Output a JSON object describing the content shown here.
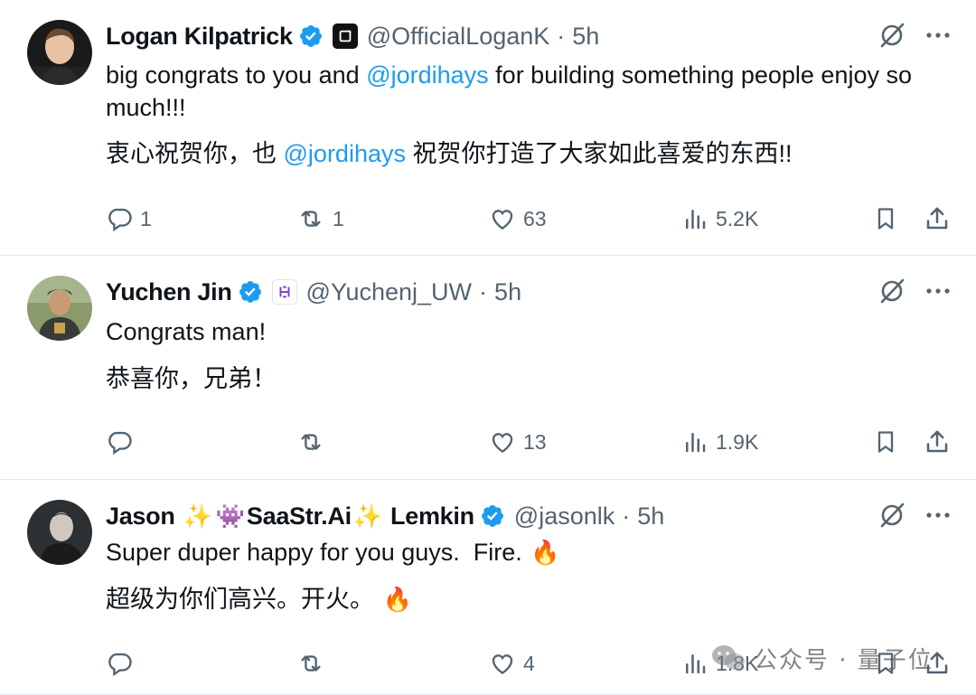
{
  "tweets": [
    {
      "name": "Logan Kilpatrick",
      "handle": "@OfficialLoganK",
      "dot": "·",
      "time": "5h",
      "line1_pre": "big congrats to you and ",
      "line1_mention": "@jordihays",
      "line1_post": " for building something people enjoy so much!!!",
      "line2_pre": "衷心祝贺你，也 ",
      "line2_mention": "@jordihays",
      "line2_post": " 祝贺你打造了大家如此喜爱的东西!!",
      "replies": "1",
      "retweets": "1",
      "likes": "63",
      "views": "5.2K"
    },
    {
      "name": "Yuchen Jin",
      "handle": "@Yuchenj_UW",
      "dot": "·",
      "time": "5h",
      "line1": "Congrats man!",
      "line2": "恭喜你，兄弟！",
      "replies": "",
      "retweets": "",
      "likes": "13",
      "views": "1.9K"
    },
    {
      "name_part1": "Jason ",
      "name_emoji1": "✨",
      "name_emoji2": "👾",
      "name_part2": "SaaStr.Ai",
      "name_emoji3": "✨",
      "name_part3": " Lemkin",
      "handle": "@jasonlk",
      "dot": "·",
      "time": "5h",
      "line1": "Super duper happy for you guys.  Fire. ",
      "line1_emoji": "🔥",
      "line2": "超级为你们高兴。开火。 ",
      "line2_emoji": "🔥",
      "replies": "",
      "retweets": "",
      "likes": "4",
      "views": "1.8K"
    }
  ],
  "watermark": "公众号 · 量子位",
  "icons": {
    "verified": "verified-badge-icon",
    "grok": "grok-icon",
    "more": "more-icon",
    "reply": "reply-icon",
    "retweet": "retweet-icon",
    "like": "like-icon",
    "views": "views-icon",
    "bookmark": "bookmark-icon",
    "share": "share-icon"
  },
  "colors": {
    "mention": "#1d9bf0",
    "verified": "#1d9bf0",
    "secondary_text": "#536471",
    "divider": "#e6e9ec"
  }
}
